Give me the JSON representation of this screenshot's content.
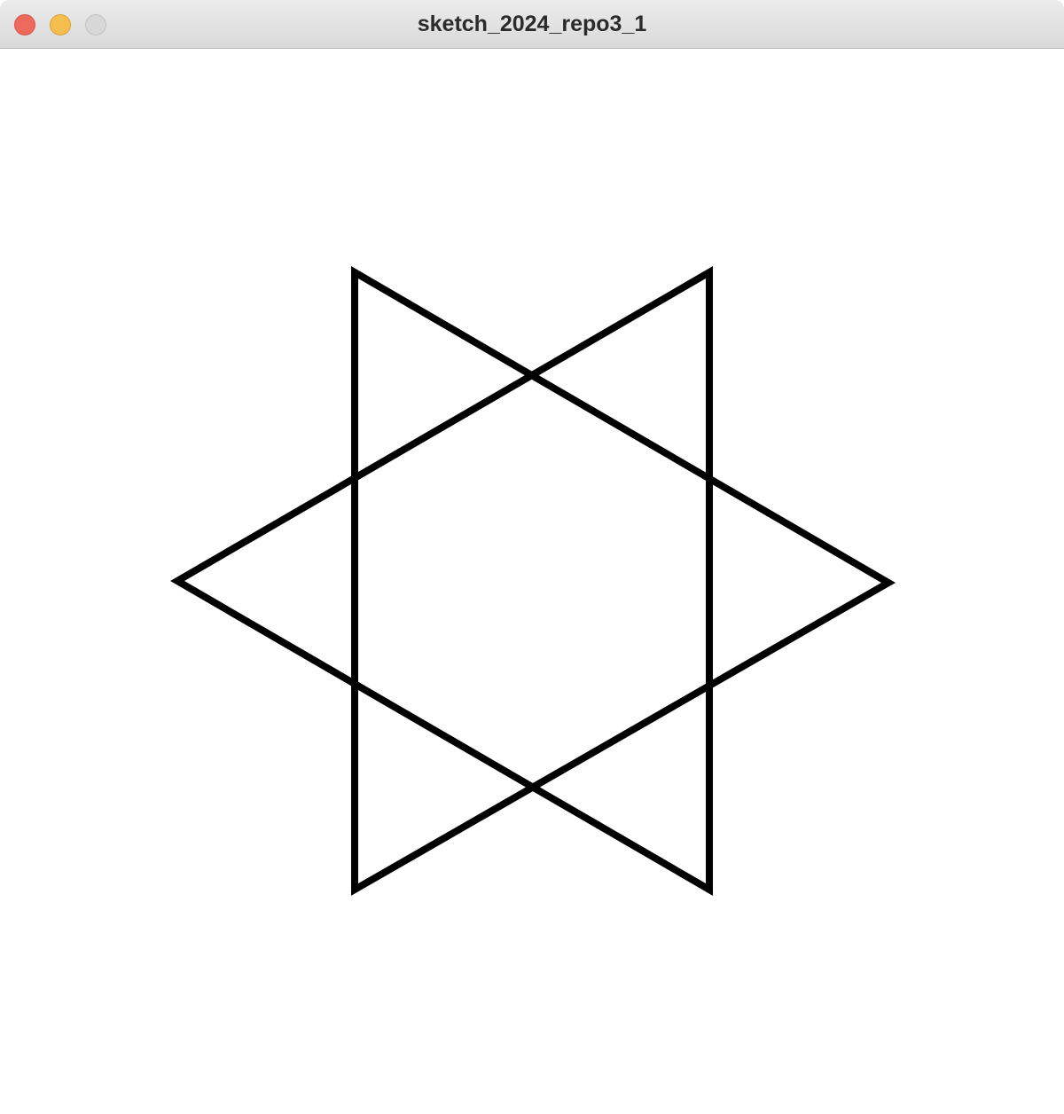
{
  "window": {
    "title": "sketch_2024_repo3_1",
    "controls": {
      "close_color": "#ee6a5f",
      "minimize_color": "#f5be4f",
      "zoom_color": "#d7d7d7"
    }
  },
  "sketch": {
    "background": "#ffffff",
    "stroke_color": "#000000",
    "shape": "hexagram"
  }
}
